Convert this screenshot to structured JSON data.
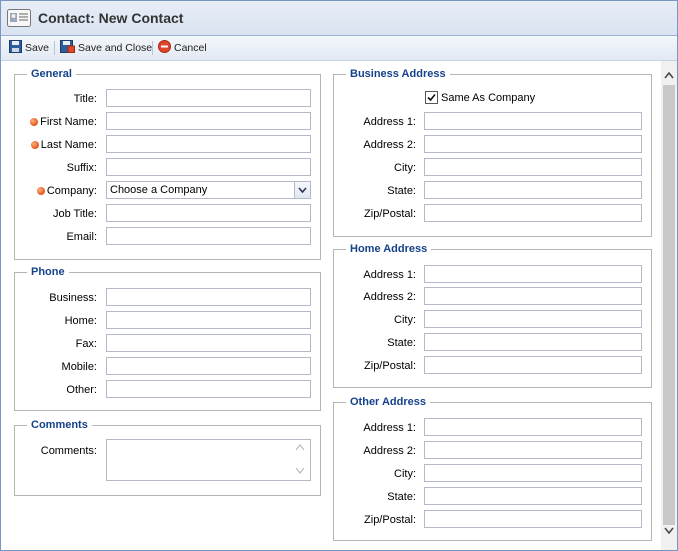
{
  "window": {
    "title": "Contact: New Contact"
  },
  "toolbar": {
    "save": "Save",
    "save_close": "Save and Close",
    "cancel": "Cancel"
  },
  "general": {
    "legend": "General",
    "title": "Title:",
    "first_name": "First Name:",
    "last_name": "Last Name:",
    "suffix": "Suffix:",
    "company": "Company:",
    "company_value": "Choose a Company",
    "job_title": "Job Title:",
    "email": "Email:"
  },
  "phone": {
    "legend": "Phone",
    "business": "Business:",
    "home": "Home:",
    "fax": "Fax:",
    "mobile": "Mobile:",
    "other": "Other:"
  },
  "comments": {
    "legend": "Comments",
    "label": "Comments:"
  },
  "business_address": {
    "legend": "Business Address",
    "same_as_company": "Same As Company",
    "same_as_company_checked": true,
    "address1": "Address 1:",
    "address2": "Address 2:",
    "city": "City:",
    "state": "State:",
    "zip": "Zip/Postal:"
  },
  "home_address": {
    "legend": "Home Address",
    "address1": "Address 1:",
    "address2": "Address 2:",
    "city": "City:",
    "state": "State:",
    "zip": "Zip/Postal:"
  },
  "other_address": {
    "legend": "Other Address",
    "address1": "Address 1:",
    "address2": "Address 2:",
    "city": "City:",
    "state": "State:",
    "zip": "Zip/Postal:"
  },
  "icons": {
    "window": "contact-card-icon",
    "save": "floppy-disk-icon",
    "save_close": "floppy-disk-close-icon",
    "cancel": "cancel-icon",
    "required": "required-dot-icon"
  },
  "colors": {
    "legend": "#15428b",
    "required": "#e0561c",
    "border": "#7a95c0"
  }
}
